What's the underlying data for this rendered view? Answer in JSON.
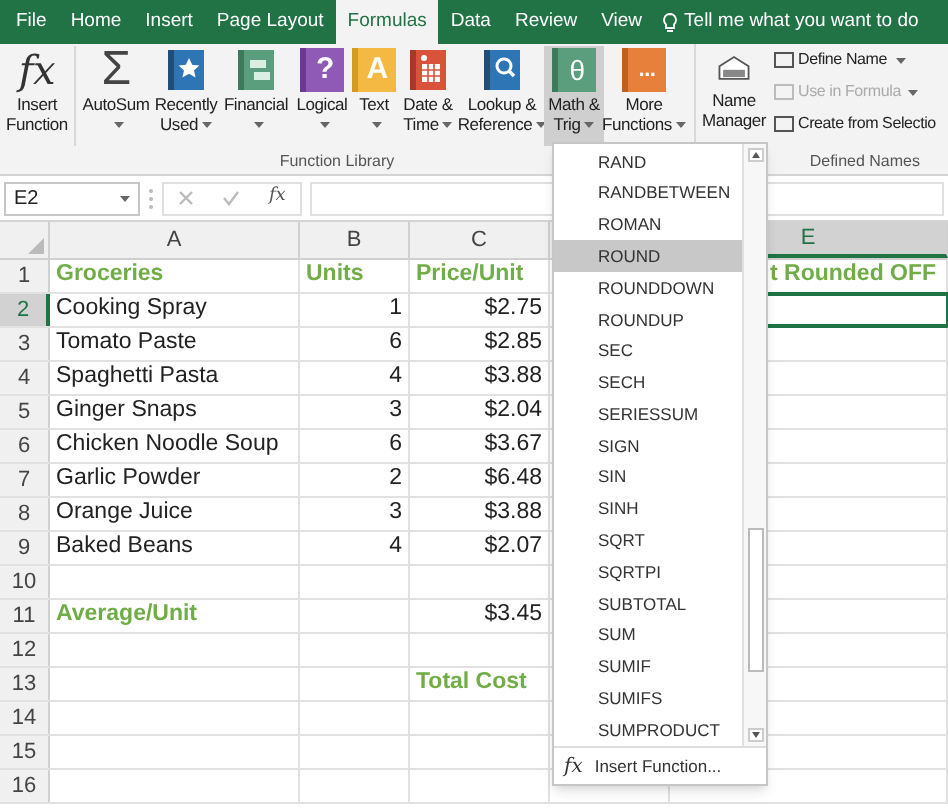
{
  "tabs": [
    {
      "label": "File",
      "selected": false
    },
    {
      "label": "Home",
      "selected": false
    },
    {
      "label": "Insert",
      "selected": false
    },
    {
      "label": "Page Layout",
      "selected": false
    },
    {
      "label": "Formulas",
      "selected": true
    },
    {
      "label": "Data",
      "selected": false
    },
    {
      "label": "Review",
      "selected": false
    },
    {
      "label": "View",
      "selected": false
    }
  ],
  "tell_me": "Tell me what you want to do",
  "function_library": {
    "label": "Function Library",
    "buttons": [
      {
        "kind": "fx",
        "glyph": "fx",
        "lines": [
          "Insert",
          "Function"
        ],
        "dropdown": false,
        "selected": false
      },
      {
        "kind": "sigma",
        "glyph": "Σ",
        "lines": [
          "AutoSum"
        ],
        "dropdown": true,
        "selected": false
      },
      {
        "kind": "star",
        "lines": [
          "Recently",
          "Used"
        ],
        "dropdown": true,
        "selected": false
      },
      {
        "kind": "finance",
        "lines": [
          "Financial"
        ],
        "dropdown": true,
        "selected": false
      },
      {
        "kind": "question",
        "glyph": "?",
        "lines": [
          "Logical"
        ],
        "dropdown": true,
        "selected": false
      },
      {
        "kind": "letter",
        "glyph": "A",
        "lines": [
          "Text"
        ],
        "dropdown": true,
        "selected": false
      },
      {
        "kind": "calendar",
        "lines": [
          "Date &",
          "Time"
        ],
        "dropdown": true,
        "selected": false
      },
      {
        "kind": "lookup",
        "lines": [
          "Lookup &",
          "Reference"
        ],
        "dropdown": true,
        "selected": false
      },
      {
        "kind": "theta",
        "glyph": "θ",
        "lines": [
          "Math &",
          "Trig"
        ],
        "dropdown": true,
        "selected": true
      },
      {
        "kind": "dots",
        "glyph": "...",
        "lines": [
          "More",
          "Functions"
        ],
        "dropdown": true,
        "selected": false
      }
    ]
  },
  "defined_names": {
    "label": "Defined Names",
    "manager": {
      "lines": [
        "Name",
        "Manager"
      ]
    },
    "items": [
      {
        "label": "Define Name",
        "dropdown": true,
        "disabled": false
      },
      {
        "label": "Use in Formula",
        "dropdown": true,
        "disabled": true
      },
      {
        "label": "Create from Selectio",
        "dropdown": false,
        "disabled": false
      }
    ]
  },
  "formula_bar": {
    "name_box": "E2",
    "fx": "fx"
  },
  "columns": [
    {
      "label": "A",
      "selected": false
    },
    {
      "label": "B",
      "selected": false
    },
    {
      "label": "C",
      "selected": false
    },
    {
      "label": "E",
      "selected": true
    }
  ],
  "rows": [
    {
      "number": "1",
      "selected": false,
      "cells": [
        {
          "text": "Groceries",
          "kind": "label"
        },
        {
          "text": "Units",
          "kind": "label"
        },
        {
          "text": "Price/Unit",
          "kind": "label"
        },
        {
          "text": "t Rounded OFF",
          "kind": "label"
        }
      ]
    },
    {
      "number": "2",
      "selected": true,
      "cells": [
        {
          "text": "Cooking Spray",
          "kind": "text"
        },
        {
          "text": "1",
          "kind": "number"
        },
        {
          "text": "$2.75",
          "kind": "number"
        },
        null
      ]
    },
    {
      "number": "3",
      "selected": false,
      "cells": [
        {
          "text": "Tomato Paste",
          "kind": "text"
        },
        {
          "text": "6",
          "kind": "number"
        },
        {
          "text": "$2.85",
          "kind": "number"
        },
        null
      ]
    },
    {
      "number": "4",
      "selected": false,
      "cells": [
        {
          "text": "Spaghetti Pasta",
          "kind": "text"
        },
        {
          "text": "4",
          "kind": "number"
        },
        {
          "text": "$3.88",
          "kind": "number"
        },
        null
      ]
    },
    {
      "number": "5",
      "selected": false,
      "cells": [
        {
          "text": "Ginger Snaps",
          "kind": "text"
        },
        {
          "text": "3",
          "kind": "number"
        },
        {
          "text": "$2.04",
          "kind": "number"
        },
        null
      ]
    },
    {
      "number": "6",
      "selected": false,
      "cells": [
        {
          "text": "Chicken Noodle Soup",
          "kind": "text"
        },
        {
          "text": "6",
          "kind": "number"
        },
        {
          "text": "$3.67",
          "kind": "number"
        },
        null
      ]
    },
    {
      "number": "7",
      "selected": false,
      "cells": [
        {
          "text": "Garlic Powder",
          "kind": "text"
        },
        {
          "text": "2",
          "kind": "number"
        },
        {
          "text": "$6.48",
          "kind": "number"
        },
        null
      ]
    },
    {
      "number": "8",
      "selected": false,
      "cells": [
        {
          "text": "Orange Juice",
          "kind": "text"
        },
        {
          "text": "3",
          "kind": "number"
        },
        {
          "text": "$3.88",
          "kind": "number"
        },
        null
      ]
    },
    {
      "number": "9",
      "selected": false,
      "cells": [
        {
          "text": "Baked Beans",
          "kind": "text"
        },
        {
          "text": "4",
          "kind": "number"
        },
        {
          "text": "$2.07",
          "kind": "number"
        },
        null
      ]
    },
    {
      "number": "10",
      "selected": false,
      "cells": [
        null,
        null,
        null,
        null
      ]
    },
    {
      "number": "11",
      "selected": false,
      "cells": [
        {
          "text": "Average/Unit",
          "kind": "label"
        },
        null,
        {
          "text": "$3.45",
          "kind": "number"
        },
        null
      ]
    },
    {
      "number": "12",
      "selected": false,
      "cells": [
        null,
        null,
        null,
        null
      ]
    },
    {
      "number": "13",
      "selected": false,
      "cells": [
        null,
        null,
        {
          "text": "Total Cost",
          "kind": "label"
        },
        null
      ]
    },
    {
      "number": "14",
      "selected": false,
      "cells": [
        null,
        null,
        null,
        null
      ]
    },
    {
      "number": "15",
      "selected": false,
      "cells": [
        null,
        null,
        null,
        null
      ]
    },
    {
      "number": "16",
      "selected": false,
      "cells": [
        null,
        null,
        null,
        null
      ]
    }
  ],
  "menu": {
    "items": [
      {
        "label": "RAND",
        "selected": false
      },
      {
        "label": "RANDBETWEEN",
        "selected": false
      },
      {
        "label": "ROMAN",
        "selected": false
      },
      {
        "label": "ROUND",
        "selected": true
      },
      {
        "label": "ROUNDDOWN",
        "selected": false
      },
      {
        "label": "ROUNDUP",
        "selected": false
      },
      {
        "label": "SEC",
        "selected": false
      },
      {
        "label": "SECH",
        "selected": false
      },
      {
        "label": "SERIESSUM",
        "selected": false
      },
      {
        "label": "SIGN",
        "selected": false
      },
      {
        "label": "SIN",
        "selected": false
      },
      {
        "label": "SINH",
        "selected": false
      },
      {
        "label": "SQRT",
        "selected": false
      },
      {
        "label": "SQRTPI",
        "selected": false
      },
      {
        "label": "SUBTOTAL",
        "selected": false
      },
      {
        "label": "SUM",
        "selected": false
      },
      {
        "label": "SUMIF",
        "selected": false
      },
      {
        "label": "SUMIFS",
        "selected": false
      },
      {
        "label": "SUMPRODUCT",
        "selected": false
      }
    ],
    "footer": {
      "glyph": "fx",
      "label": "Insert Function..."
    }
  }
}
